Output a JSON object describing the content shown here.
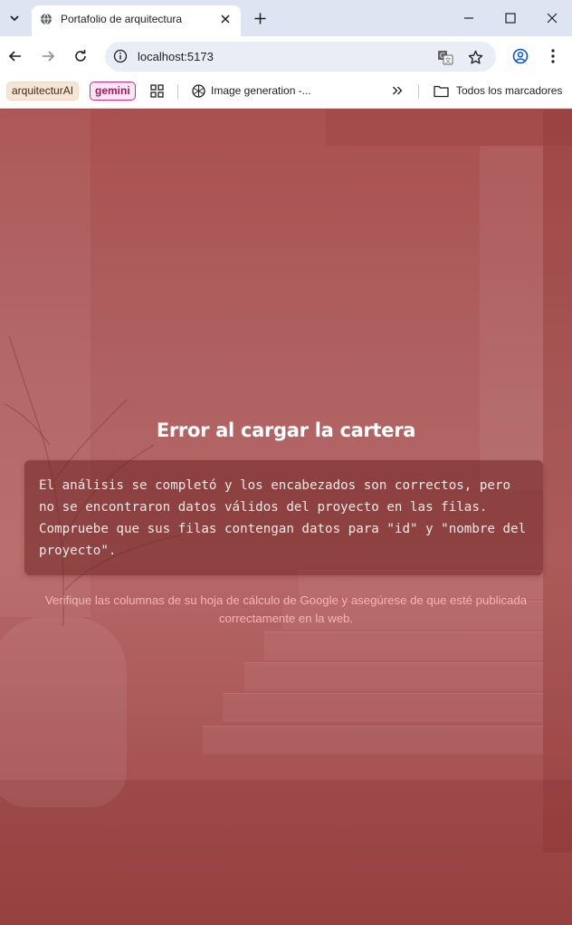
{
  "browser": {
    "tab": {
      "title": "Portafolio de arquitectura"
    },
    "omnibox": {
      "url": "localhost:5173"
    },
    "bookmarks": {
      "items": [
        {
          "label": "arquitecturAI",
          "kind": "chip",
          "color": "#f6e5d4"
        },
        {
          "label": "gemini",
          "kind": "chip",
          "color": "#c2337f"
        },
        {
          "label": "Image generation -...",
          "kind": "link",
          "icon": "openai-icon"
        }
      ],
      "all_bookmarks_label": "Todos los marcadores"
    },
    "icons": {
      "tab_menu": "chevron-down-icon",
      "favicon": "globe-icon",
      "close": "close-icon",
      "new_tab": "plus-icon",
      "minimize": "minimize-icon",
      "maximize": "maximize-icon",
      "window_close": "close-icon",
      "back": "arrow-left-icon",
      "forward": "arrow-right-icon",
      "reload": "reload-icon",
      "site_info": "info-icon",
      "translate": "translate-icon",
      "star": "star-icon",
      "profile": "profile-icon",
      "more": "kebab-icon",
      "apps": "apps-grid-icon",
      "overflow": "double-chevron-icon",
      "folder": "folder-icon"
    }
  },
  "page": {
    "error_title": "Error al cargar la cartera",
    "error_message": "El análisis se completó y los encabezados son correctos, pero no se encontraron datos válidos del proyecto en las filas. Compruebe que sus filas contengan datos para \"id\" y \"nombre del proyecto\".",
    "hint": "Verifique las columnas de su hoja de cálculo de Google y asegúrese de que esté publicada correctamente en la web.",
    "colors": {
      "background": "#a84a4a",
      "hint_text": "#f6b4b4",
      "title_text": "#ffffff"
    }
  }
}
